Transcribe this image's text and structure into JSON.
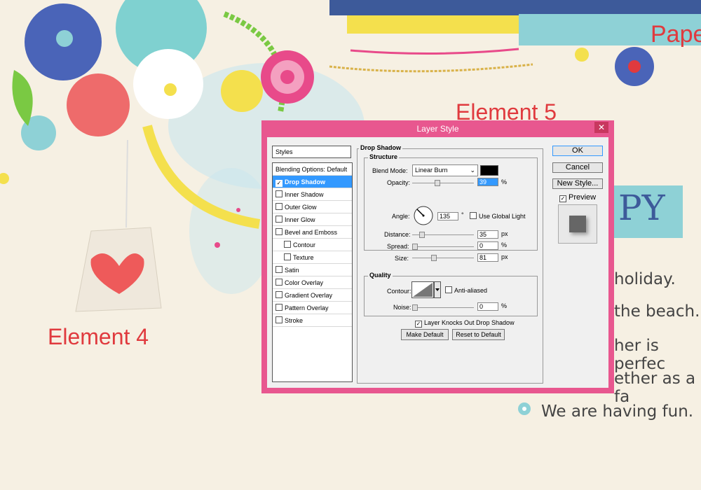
{
  "labels": {
    "element4": "Element 4",
    "element5": "Element 5",
    "paper": "Pape",
    "happy": "PY"
  },
  "journal": [
    "holiday.",
    "the beach.",
    "her is perfec",
    "ether as a fa",
    "We are having fun."
  ],
  "dialog": {
    "title": "Layer Style",
    "styles_header": "Styles",
    "styles": [
      {
        "label": "Blending Options: Default",
        "check": false,
        "indent": 0
      },
      {
        "label": "Drop Shadow",
        "check": true,
        "checked": true,
        "selected": true,
        "indent": 0
      },
      {
        "label": "Inner Shadow",
        "check": true,
        "checked": false,
        "indent": 0
      },
      {
        "label": "Outer Glow",
        "check": true,
        "checked": false,
        "indent": 0
      },
      {
        "label": "Inner Glow",
        "check": true,
        "checked": false,
        "indent": 0
      },
      {
        "label": "Bevel and Emboss",
        "check": true,
        "checked": false,
        "indent": 0
      },
      {
        "label": "Contour",
        "check": true,
        "checked": false,
        "indent": 1
      },
      {
        "label": "Texture",
        "check": true,
        "checked": false,
        "indent": 1
      },
      {
        "label": "Satin",
        "check": true,
        "checked": false,
        "indent": 0
      },
      {
        "label": "Color Overlay",
        "check": true,
        "checked": false,
        "indent": 0
      },
      {
        "label": "Gradient Overlay",
        "check": true,
        "checked": false,
        "indent": 0
      },
      {
        "label": "Pattern Overlay",
        "check": true,
        "checked": false,
        "indent": 0
      },
      {
        "label": "Stroke",
        "check": true,
        "checked": false,
        "indent": 0
      }
    ],
    "drop_shadow_title": "Drop Shadow",
    "structure_title": "Structure",
    "blend_mode_label": "Blend Mode:",
    "blend_mode_value": "Linear Burn",
    "shadow_color": "#000000",
    "opacity_label": "Opacity:",
    "opacity_value": "39",
    "opacity_fraction": 0.39,
    "pct": "%",
    "angle_label": "Angle:",
    "angle_value": "135",
    "deg": "°",
    "use_global_light": "Use Global Light",
    "distance_label": "Distance:",
    "distance_value": "35",
    "distance_fraction": 0.12,
    "spread_label": "Spread:",
    "spread_value": "0",
    "spread_fraction": 0,
    "size_label": "Size:",
    "size_value": "81",
    "size_fraction": 0.33,
    "px": "px",
    "quality_title": "Quality",
    "contour_label": "Contour:",
    "anti_aliased": "Anti-aliased",
    "noise_label": "Noise:",
    "noise_value": "0",
    "noise_fraction": 0,
    "knocks_out": "Layer Knocks Out Drop Shadow",
    "make_default": "Make Default",
    "reset_default": "Reset to Default",
    "ok": "OK",
    "cancel": "Cancel",
    "new_style": "New Style...",
    "preview": "Preview"
  }
}
